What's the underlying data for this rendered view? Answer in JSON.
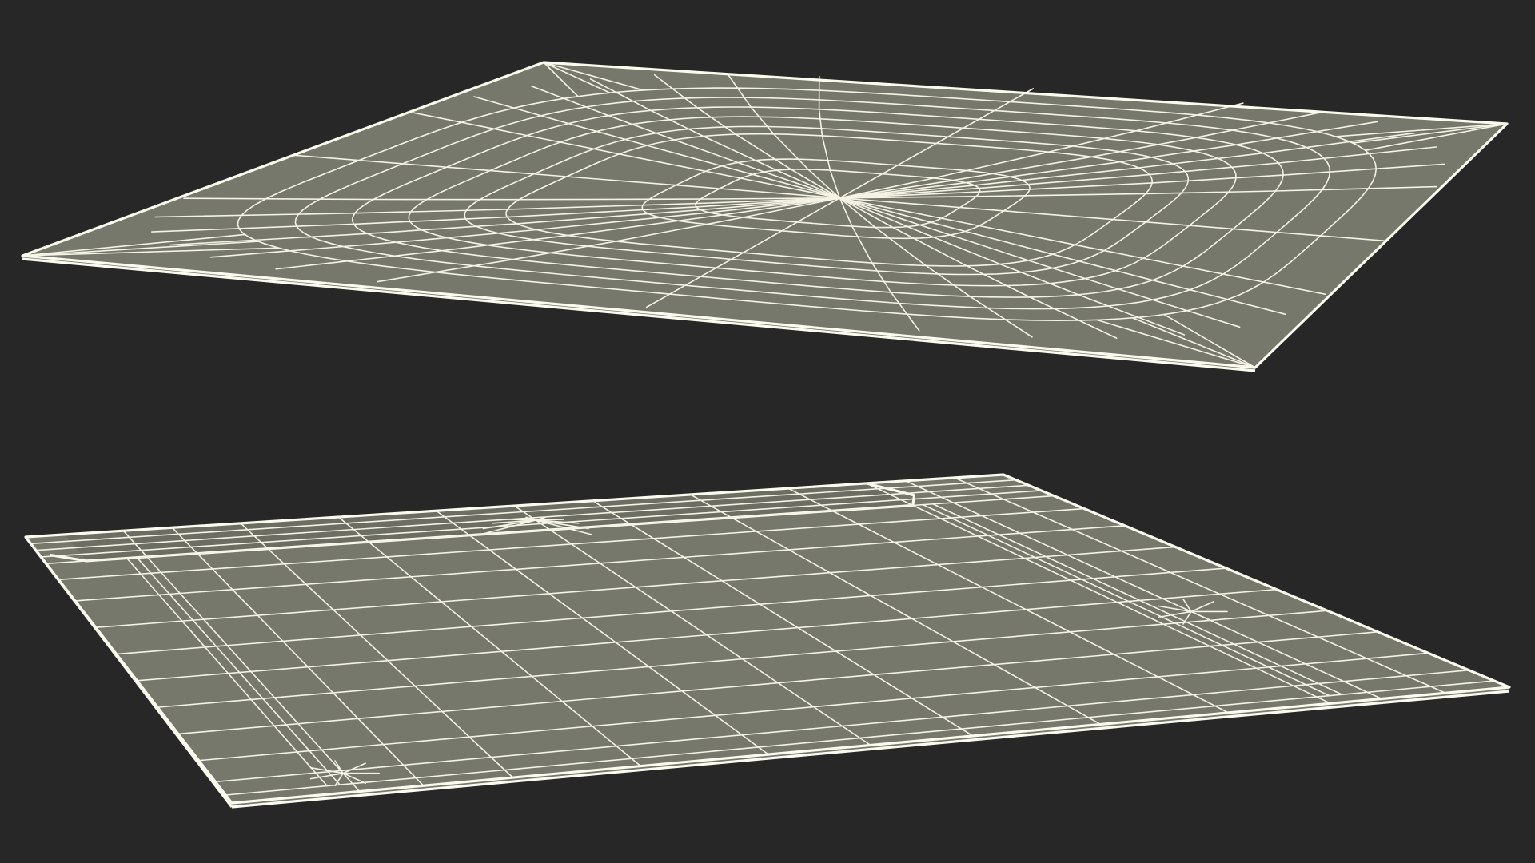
{
  "render": {
    "background_color": "#272727",
    "surface_color": "#77786c",
    "wire_color": "#f4f3e4",
    "edge_color": "#fbfaee"
  },
  "scene": {
    "objects": [
      {
        "name": "upper-plate",
        "mesh_style": "radial spokes with concentric rounded-rectangle rings"
      },
      {
        "name": "lower-plate",
        "mesh_style": "rectangular grid with raised rim along back and side edges"
      }
    ]
  }
}
